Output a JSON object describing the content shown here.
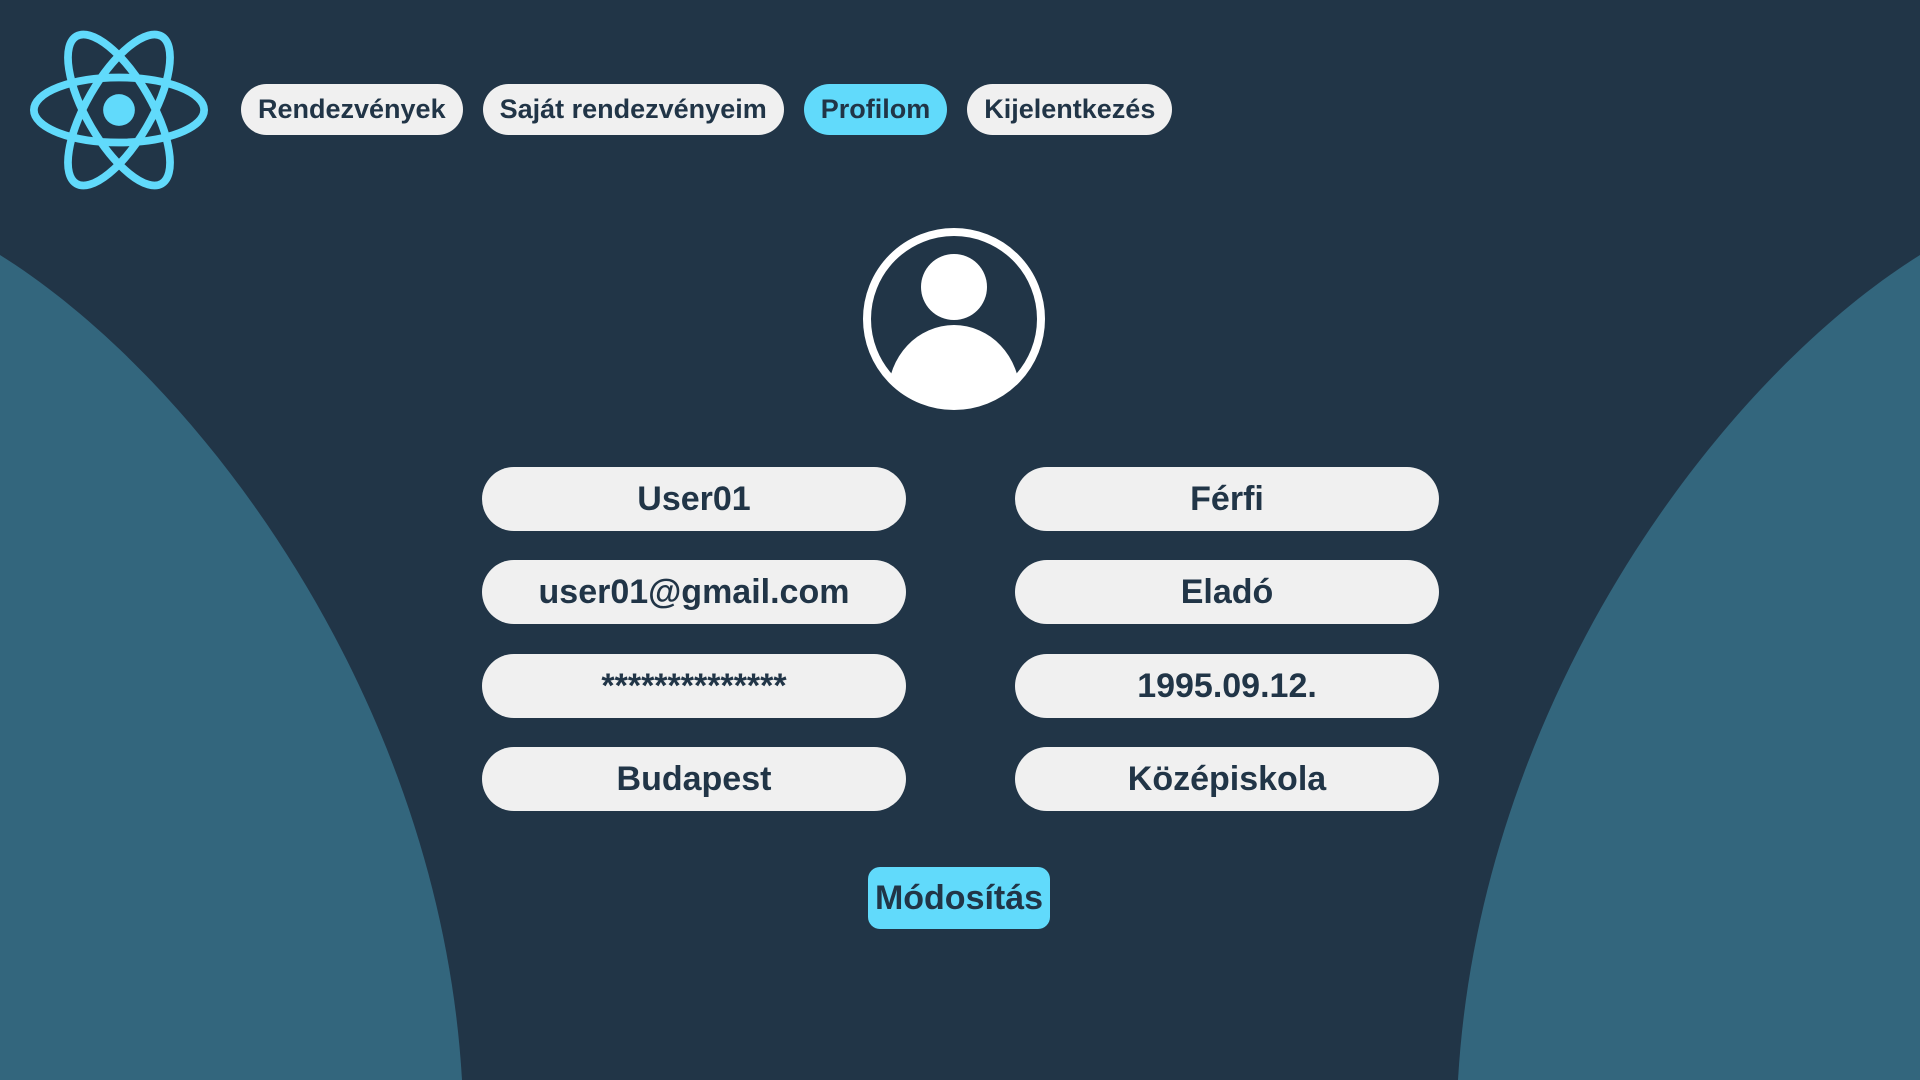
{
  "theme": {
    "background": "#213547",
    "curve_color": "#33667d",
    "accent": "#61dafb",
    "field_background": "#f0f0f0",
    "text_color": "#213547"
  },
  "header": {
    "logo_icon": "react-atom-icon",
    "nav": [
      {
        "label": "Rendezvények",
        "active": false
      },
      {
        "label": "Saját rendezvényeim",
        "active": false
      },
      {
        "label": "Profilom",
        "active": true
      },
      {
        "label": "Kijelentkezés",
        "active": false
      }
    ]
  },
  "profile": {
    "avatar_icon": "user-avatar-icon",
    "fields_left": [
      "User01",
      "user01@gmail.com",
      "**************",
      "Budapest"
    ],
    "fields_right": [
      "Férfi",
      "Eladó",
      "1995.09.12.",
      "Középiskola"
    ],
    "submit_label": "Módosítás"
  }
}
